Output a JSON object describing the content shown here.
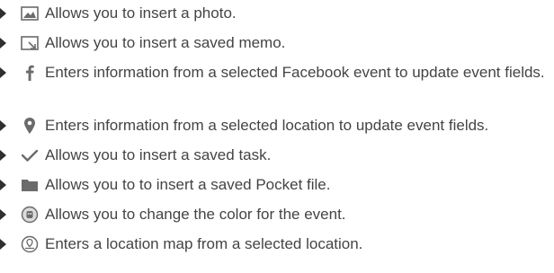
{
  "items": [
    {
      "icon": "photo-icon",
      "text": "Allows you to insert a photo."
    },
    {
      "icon": "memo-icon",
      "text": "Allows you to insert a saved memo."
    },
    {
      "icon": "facebook-icon",
      "text": "Enters information from a selected Facebook event to update event fields."
    },
    {
      "icon": "location-pin-icon",
      "text": "Enters information from a selected location to update event fields."
    },
    {
      "icon": "checkmark-icon",
      "text": "Allows you to insert a saved task."
    },
    {
      "icon": "folder-icon",
      "text": "Allows you to to insert a saved Pocket file."
    },
    {
      "icon": "color-palette-icon",
      "text": "Allows you to change the color for the event."
    },
    {
      "icon": "map-icon",
      "text": "Enters a location map from a selected location."
    }
  ],
  "colors": {
    "text": "#444444",
    "icon": "#6b6b6b",
    "bullet": "#2f2f2f"
  }
}
